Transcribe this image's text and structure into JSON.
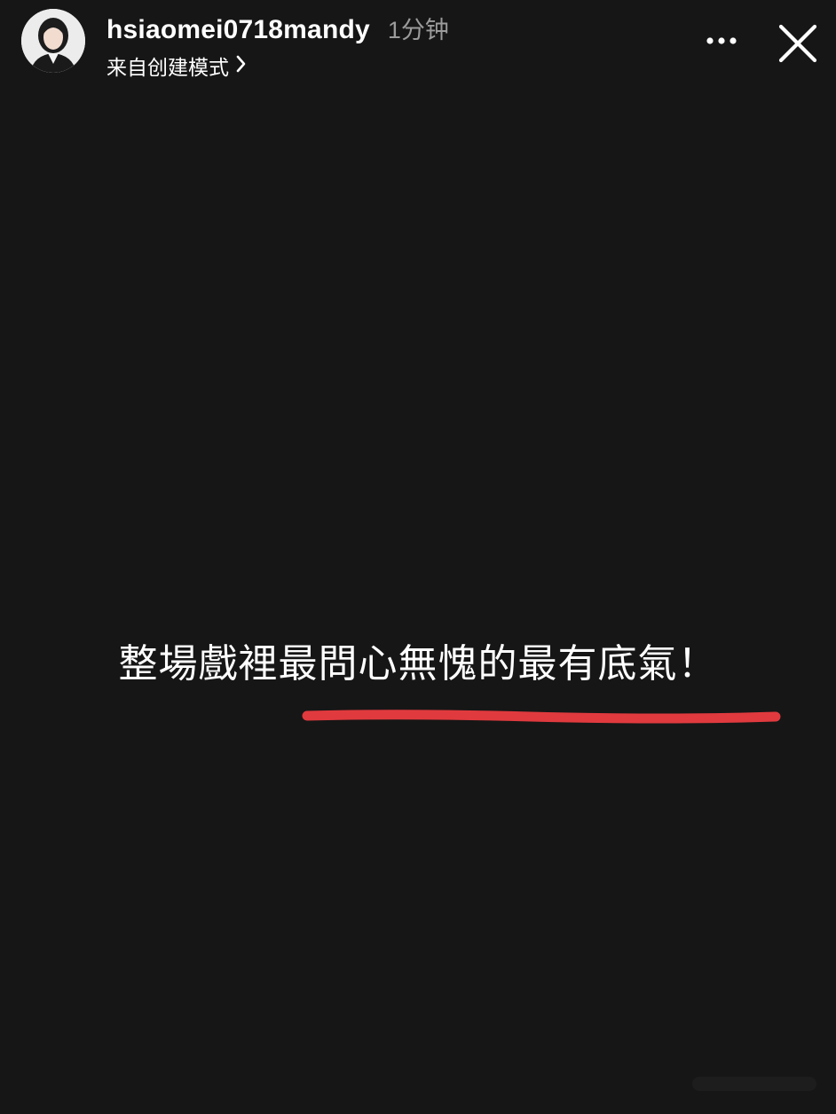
{
  "header": {
    "username": "hsiaomei0718mandy",
    "time": "1分钟",
    "source": "来自创建模式",
    "more_icon": "more-horizontal-icon",
    "close_icon": "close-icon",
    "chevron_icon": "chevron-right-icon"
  },
  "story": {
    "caption": "整場戲裡最問心無愧的最有底氣！",
    "underline_color": "#e03a3e",
    "background_color": "#161616"
  }
}
